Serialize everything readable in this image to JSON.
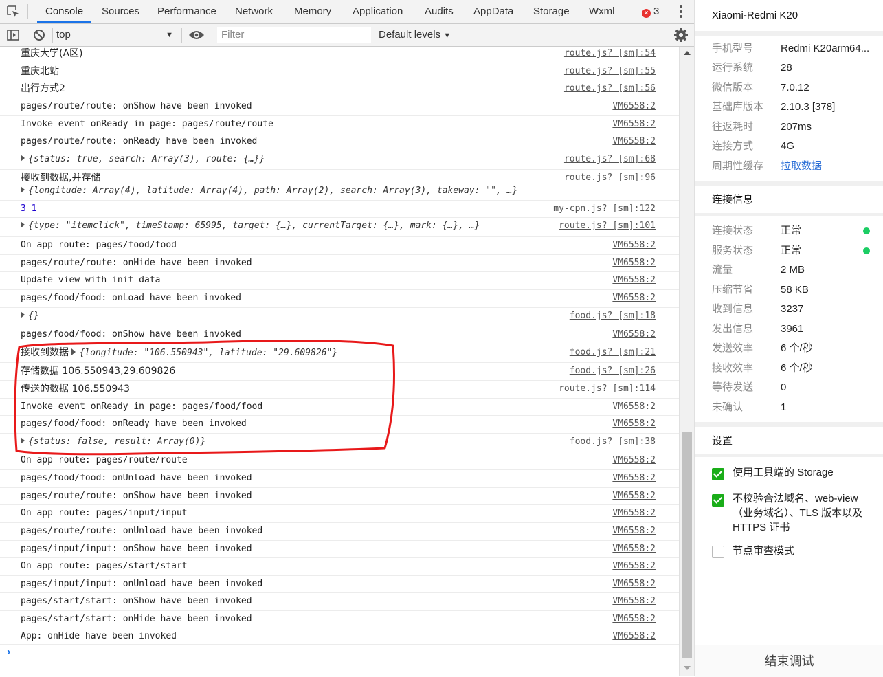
{
  "tabs": [
    {
      "label": "Console",
      "active": true
    },
    {
      "label": "Sources"
    },
    {
      "label": "Performance"
    },
    {
      "label": "Network"
    },
    {
      "label": "Memory"
    },
    {
      "label": "Application"
    },
    {
      "label": "Audits"
    },
    {
      "label": "AppData"
    },
    {
      "label": "Storage"
    },
    {
      "label": "Wxml"
    }
  ],
  "error_count": "3",
  "toolbar": {
    "context": "top",
    "filter_placeholder": "Filter",
    "levels": "Default levels"
  },
  "logs": [
    {
      "text": "重庆大学(A区)",
      "src": "route.js? [sm]:54",
      "cjk": true
    },
    {
      "text": "重庆北站",
      "src": "route.js? [sm]:55",
      "cjk": true
    },
    {
      "text": "出行方式2",
      "src": "route.js? [sm]:56",
      "cjk": true
    },
    {
      "text": "pages/route/route: onShow have been invoked",
      "src": "VM6558:2"
    },
    {
      "text": "Invoke event onReady in page: pages/route/route",
      "src": "VM6558:2"
    },
    {
      "text": "pages/route/route: onReady have been invoked",
      "src": "VM6558:2"
    },
    {
      "text": "{status: true, search: Array(3), route: {…}}",
      "src": "route.js? [sm]:68"
    },
    {
      "text": "接收到数据,并存储",
      "src": "route.js? [sm]:96",
      "cjk": true
    },
    {
      "text": "{longitude: Array(4), latitude: Array(4), path: Array(2), search: Array(3), takeway: \"\", …}",
      "src": ""
    },
    {
      "text": "3 1",
      "src": "my-cpn.js? [sm]:122"
    },
    {
      "text": "{type: \"itemclick\", timeStamp: 65995, target: {…}, currentTarget: {…}, mark: {…}, …}",
      "src": "route.js? [sm]:101"
    },
    {
      "text": "On app route: pages/food/food",
      "src": "VM6558:2"
    },
    {
      "text": "pages/route/route: onHide have been invoked",
      "src": "VM6558:2"
    },
    {
      "text": "Update view with init data",
      "src": "VM6558:2"
    },
    {
      "text": "pages/food/food: onLoad have been invoked",
      "src": "VM6558:2"
    },
    {
      "text": "{}",
      "src": "food.js? [sm]:18"
    },
    {
      "text": "pages/food/food: onShow have been invoked",
      "src": "VM6558:2"
    },
    {
      "text": "接收到数据 ",
      "text2": "{longitude: \"106.550943\", latitude: \"29.609826\"}",
      "src": "food.js? [sm]:21",
      "cjk": true
    },
    {
      "text": "存储数据 106.550943,29.609826",
      "src": "food.js? [sm]:26",
      "cjk": true
    },
    {
      "text": "传送的数据 106.550943",
      "src": "route.js? [sm]:114",
      "cjk": true
    },
    {
      "text": "Invoke event onReady in page: pages/food/food",
      "src": "VM6558:2"
    },
    {
      "text": "pages/food/food: onReady have been invoked",
      "src": "VM6558:2"
    },
    {
      "text": "{status: false, result: Array(0)}",
      "src": "food.js? [sm]:38"
    },
    {
      "text": "On app route: pages/route/route",
      "src": "VM6558:2"
    },
    {
      "text": "pages/food/food: onUnload have been invoked",
      "src": "VM6558:2"
    },
    {
      "text": "pages/route/route: onShow have been invoked",
      "src": "VM6558:2"
    },
    {
      "text": "On app route: pages/input/input",
      "src": "VM6558:2"
    },
    {
      "text": "pages/route/route: onUnload have been invoked",
      "src": "VM6558:2"
    },
    {
      "text": "pages/input/input: onShow have been invoked",
      "src": "VM6558:2"
    },
    {
      "text": "On app route: pages/start/start",
      "src": "VM6558:2"
    },
    {
      "text": "pages/input/input: onUnload have been invoked",
      "src": "VM6558:2"
    },
    {
      "text": "pages/start/start: onShow have been invoked",
      "src": "VM6558:2"
    },
    {
      "text": "pages/start/start: onHide have been invoked",
      "src": "VM6558:2"
    },
    {
      "text": "App: onHide have been invoked",
      "src": "VM6558:2"
    }
  ],
  "panel": {
    "device_title": "Xiaomi-Redmi K20",
    "info": [
      {
        "k": "手机型号",
        "v": "Redmi K20arm64..."
      },
      {
        "k": "运行系统",
        "v": "28"
      },
      {
        "k": "微信版本",
        "v": "7.0.12"
      },
      {
        "k": "基础库版本",
        "v": "2.10.3 [378]"
      },
      {
        "k": "往返耗时",
        "v": "207ms"
      },
      {
        "k": "连接方式",
        "v": "4G"
      },
      {
        "k": "周期性缓存",
        "v": "拉取数据"
      }
    ],
    "conn_title": "连接信息",
    "conn": [
      {
        "k": "连接状态",
        "v": "正常"
      },
      {
        "k": "服务状态",
        "v": "正常"
      },
      {
        "k": "流量",
        "v": "2 MB"
      },
      {
        "k": "压缩节省",
        "v": "58 KB"
      },
      {
        "k": "收到信息",
        "v": "3237"
      },
      {
        "k": "发出信息",
        "v": "3961"
      },
      {
        "k": "发送效率",
        "v": "6 个/秒"
      },
      {
        "k": "接收效率",
        "v": "6 个/秒"
      },
      {
        "k": "等待发送",
        "v": "0"
      },
      {
        "k": "未确认",
        "v": "1"
      }
    ],
    "settings_title": "设置",
    "settings": [
      {
        "label": "使用工具端的 Storage",
        "checked": true
      },
      {
        "label": "不校验合法域名、web-view（业务域名）、TLS 版本以及 HTTPS 证书",
        "checked": true
      },
      {
        "label": "节点审查模式",
        "checked": false
      }
    ],
    "end_button": "结束调试"
  },
  "colors": {
    "accent": "#1a73e8",
    "status_ok": "#1ccd64",
    "checkbox": "#1aad19",
    "annotation": "#e8191a"
  }
}
